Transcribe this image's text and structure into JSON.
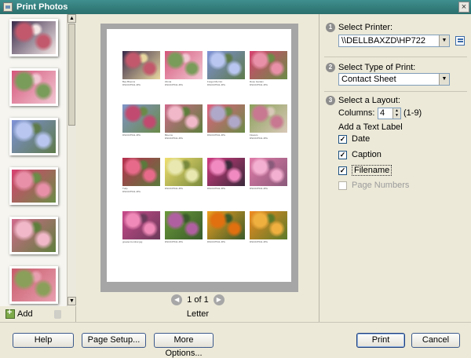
{
  "window": {
    "title": "Print Photos",
    "close_glyph": "×"
  },
  "thumbnails": {
    "items": [
      {
        "name": "photo-1",
        "colors": [
          "#3a2a4a",
          "#c2586b",
          "#f4e8e6"
        ]
      },
      {
        "name": "photo-2",
        "colors": [
          "#d5557a",
          "#7a9c5a",
          "#f2c8d4"
        ]
      },
      {
        "name": "photo-3",
        "colors": [
          "#7f92d8",
          "#b8c6f0",
          "#5d7a4a"
        ]
      },
      {
        "name": "photo-4",
        "colors": [
          "#d84070",
          "#e890a8",
          "#6a8c46"
        ]
      },
      {
        "name": "photo-5",
        "colors": [
          "#d06a8c",
          "#f0b8c8",
          "#5e7e3c"
        ]
      },
      {
        "name": "photo-6",
        "colors": [
          "#c85a6a",
          "#8aa05a",
          "#e8a0b0"
        ]
      }
    ],
    "add_label": "Add",
    "scroll_up": "▲",
    "scroll_down": "▼"
  },
  "preview": {
    "cells": [
      {
        "colors": [
          "#3a2a4a",
          "#c2586b",
          "#e8d8a0"
        ],
        "lines": [
          "Bee Blooms",
          "DSC047541.JPG"
        ]
      },
      {
        "colors": [
          "#d5557a",
          "#7a9c5a",
          "#f2c8d4"
        ],
        "lines": [
          "Zinnia",
          "DSC047541.JPG"
        ]
      },
      {
        "colors": [
          "#7f92d8",
          "#b8c6f0",
          "#5d7a4a"
        ],
        "lines": [
          "Forget Me Not",
          "DSC047541.JPG"
        ]
      },
      {
        "colors": [
          "#d84070",
          "#e890a8",
          "#6a8c46"
        ],
        "lines": [
          "Rose Garden",
          "DSC047541.JPG"
        ]
      },
      {
        "colors": [
          "#8094c8",
          "#c04a70",
          "#6a8a48"
        ],
        "lines": [
          "",
          "DSC047541.JPG"
        ]
      },
      {
        "colors": [
          "#d06a8c",
          "#f0b8c8",
          "#5e7e3c"
        ],
        "lines": [
          "Blooms",
          "DSC047541.JPG"
        ]
      },
      {
        "colors": [
          "#e06080",
          "#b0a8c8",
          "#6a8a46"
        ],
        "lines": [
          "",
          "DSC047541.JPG"
        ]
      },
      {
        "colors": [
          "#8aa05a",
          "#c87890",
          "#d8c8b8"
        ],
        "lines": [
          "Flowers",
          "DSC047541.JPG"
        ]
      },
      {
        "colors": [
          "#b83050",
          "#e86a8a",
          "#5a7a3c"
        ],
        "lines": [
          "Tulip",
          "DSC047541.JPG"
        ]
      },
      {
        "colors": [
          "#f0e070",
          "#e8e8b0",
          "#7a8a3c"
        ],
        "lines": [
          "",
          "DSC047541.JPG"
        ]
      },
      {
        "colors": [
          "#d03a80",
          "#f08ac0",
          "#3a2a3a"
        ],
        "lines": [
          "",
          "DSC047541.JPG"
        ]
      },
      {
        "colors": [
          "#e07aa8",
          "#f4b0d0",
          "#8a5a7a"
        ],
        "lines": [
          "",
          "DSC047541.JPG"
        ]
      },
      {
        "colors": [
          "#c84a8a",
          "#f08ab8",
          "#6a3a5a"
        ],
        "lines": [
          "",
          "greater-bombur.jpg"
        ]
      },
      {
        "colors": [
          "#6a9a3a",
          "#b060a0",
          "#3a5a2a"
        ],
        "lines": [
          "",
          "DSC047541.JPG"
        ]
      },
      {
        "colors": [
          "#f0a020",
          "#e07010",
          "#3a5a2a"
        ],
        "lines": [
          "",
          "DSC047541.JPG"
        ]
      },
      {
        "colors": [
          "#f08a20",
          "#f0b040",
          "#5a7a2a"
        ],
        "lines": [
          "",
          "DSC047541.JPG"
        ]
      }
    ],
    "page_indicator": "1 of 1",
    "prev_glyph": "◀",
    "next_glyph": "▶",
    "paper_size": "Letter"
  },
  "options": {
    "printer": {
      "step": "1",
      "heading": "Select Printer:",
      "value": "\\\\DELLBAXZD\\HP722"
    },
    "print_type": {
      "step": "2",
      "heading": "Select Type of Print:",
      "value": "Contact Sheet"
    },
    "layout": {
      "step": "3",
      "heading": "Select a Layout:",
      "columns_label": "Columns:",
      "columns_value": "4",
      "columns_range": "(1-9)",
      "text_label_heading": "Add a Text Label",
      "checkboxes": [
        {
          "label": "Date",
          "checked": true
        },
        {
          "label": "Caption",
          "checked": true
        },
        {
          "label": "Filename",
          "checked": true
        },
        {
          "label": "Page Numbers",
          "checked": false
        }
      ]
    },
    "combo_arrow": "▼",
    "check_glyph": "✓"
  },
  "buttons": {
    "help": "Help",
    "page_setup": "Page Setup...",
    "more_options": "More Options...",
    "print": "Print",
    "cancel": "Cancel"
  }
}
